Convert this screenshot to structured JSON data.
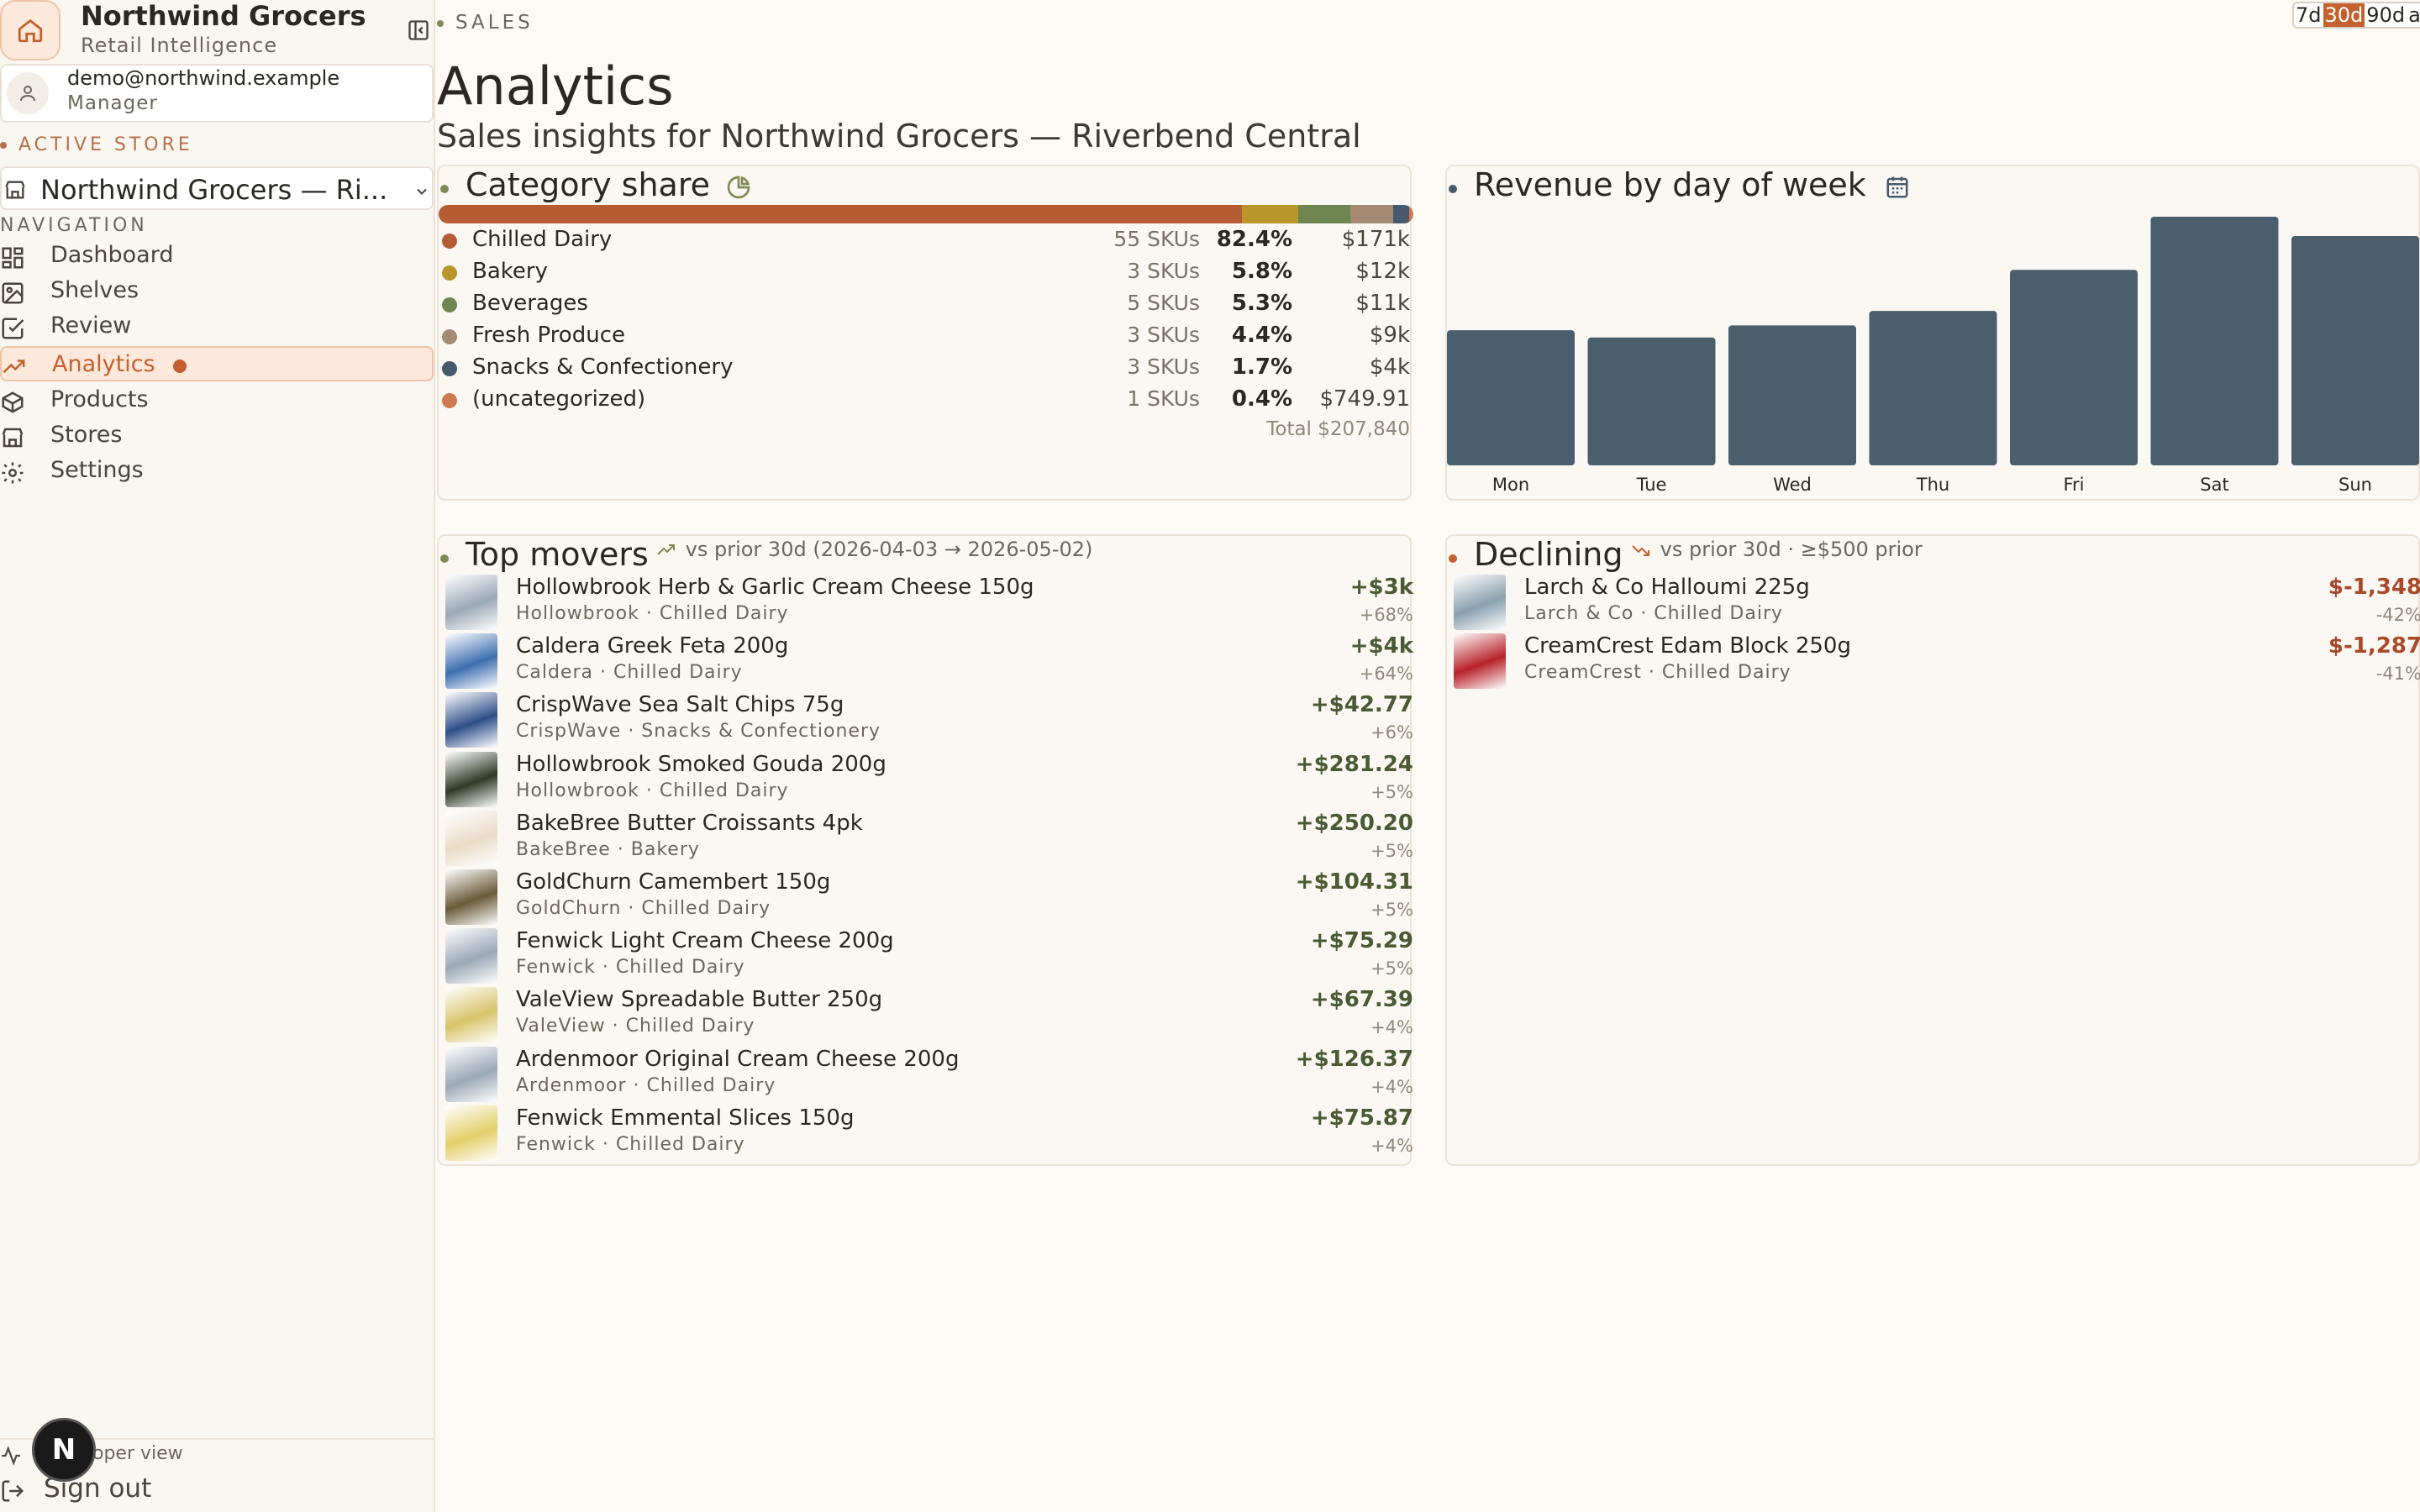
{
  "brand": {
    "name": "Northwind Grocers",
    "subtitle": "Retail Intelligence"
  },
  "user": {
    "email": "demo@northwind.example",
    "role": "Manager"
  },
  "sidebar": {
    "active_store_label": "ACTIVE STORE",
    "store_name": "Northwind Grocers — Ri...",
    "nav_label": "NAVIGATION",
    "items": [
      {
        "label": "Dashboard",
        "icon": "grid-icon"
      },
      {
        "label": "Shelves",
        "icon": "image-icon"
      },
      {
        "label": "Review",
        "icon": "checkbox-icon"
      },
      {
        "label": "Analytics",
        "icon": "trend-up-icon"
      },
      {
        "label": "Products",
        "icon": "box-icon"
      },
      {
        "label": "Stores",
        "icon": "storefront-icon"
      },
      {
        "label": "Settings",
        "icon": "gear-icon"
      }
    ],
    "active_item": "Analytics",
    "developer_view": "oper view",
    "sign_out": "Sign out",
    "avatar_letter": "N"
  },
  "header": {
    "eyebrow": "SALES",
    "title": "Analytics",
    "subtitle": "Sales insights for Northwind Grocers — Riverbend Central",
    "ranges": [
      "7d",
      "30d",
      "90d",
      "all"
    ],
    "selected_range": "30d"
  },
  "category_share": {
    "title": "Category share",
    "rows": [
      {
        "name": "Chilled Dairy",
        "skus": "55 SKUs",
        "pct": "82.4%",
        "amount": "$171k",
        "share": 82.4,
        "color": "#b65c35"
      },
      {
        "name": "Bakery",
        "skus": "3 SKUs",
        "pct": "5.8%",
        "amount": "$12k",
        "share": 5.8,
        "color": "#b8962a"
      },
      {
        "name": "Beverages",
        "skus": "5 SKUs",
        "pct": "5.3%",
        "amount": "$11k",
        "share": 5.3,
        "color": "#6f8650"
      },
      {
        "name": "Fresh Produce",
        "skus": "3 SKUs",
        "pct": "4.4%",
        "amount": "$9k",
        "share": 4.4,
        "color": "#a38a70"
      },
      {
        "name": "Snacks & Confectionery",
        "skus": "3 SKUs",
        "pct": "1.7%",
        "amount": "$4k",
        "share": 1.7,
        "color": "#465a6b"
      },
      {
        "name": "(uncategorized)",
        "skus": "1 SKUs",
        "pct": "0.4%",
        "amount": "$749.91",
        "share": 0.4,
        "color": "#d27a4f"
      }
    ],
    "total": "Total $207,840"
  },
  "chart_data": {
    "type": "bar",
    "title": "Revenue by day of week",
    "categories": [
      "Mon",
      "Tue",
      "Wed",
      "Thu",
      "Fri",
      "Sat",
      "Sun"
    ],
    "values": [
      28,
      26.5,
      29,
      32,
      40.5,
      51.5,
      47.5
    ],
    "color": "#4a5f6e"
  },
  "top_movers": {
    "title": "Top movers",
    "note": "vs prior 30d (2026-04-03 → 2026-05-02)",
    "items": [
      {
        "name": "Hollowbrook Herb & Garlic Cream Cheese 150g",
        "meta": "Hollowbrook · Chilled Dairy",
        "value": "+$3k",
        "change": "+68%",
        "thumb": "#9aa8b6"
      },
      {
        "name": "Caldera Greek Feta 200g",
        "meta": "Caldera · Chilled Dairy",
        "value": "+$4k",
        "change": "+64%",
        "thumb": "#3f6fb0"
      },
      {
        "name": "CrispWave Sea Salt Chips 75g",
        "meta": "CrispWave · Snacks & Confectionery",
        "value": "+$42.77",
        "change": "+6%",
        "thumb": "#2f4f8a"
      },
      {
        "name": "Hollowbrook Smoked Gouda 200g",
        "meta": "Hollowbrook · Chilled Dairy",
        "value": "+$281.24",
        "change": "+5%",
        "thumb": "#2d3b26"
      },
      {
        "name": "BakeBree Butter Croissants 4pk",
        "meta": "BakeBree · Bakery",
        "value": "+$250.20",
        "change": "+5%",
        "thumb": "#e9dcc8"
      },
      {
        "name": "GoldChurn Camembert 150g",
        "meta": "GoldChurn · Chilled Dairy",
        "value": "+$104.31",
        "change": "+5%",
        "thumb": "#6b5a3a"
      },
      {
        "name": "Fenwick Light Cream Cheese 200g",
        "meta": "Fenwick · Chilled Dairy",
        "value": "+$75.29",
        "change": "+5%",
        "thumb": "#9aa8b6"
      },
      {
        "name": "ValeView Spreadable Butter 250g",
        "meta": "ValeView · Chilled Dairy",
        "value": "+$67.39",
        "change": "+4%",
        "thumb": "#d8c46a"
      },
      {
        "name": "Ardenmoor Original Cream Cheese 200g",
        "meta": "Ardenmoor · Chilled Dairy",
        "value": "+$126.37",
        "change": "+4%",
        "thumb": "#9aa8b6"
      },
      {
        "name": "Fenwick Emmental Slices 150g",
        "meta": "Fenwick · Chilled Dairy",
        "value": "+$75.87",
        "change": "+4%",
        "thumb": "#e3cf6a"
      }
    ]
  },
  "declining": {
    "title": "Declining",
    "note": "vs prior 30d · ≥$500 prior",
    "items": [
      {
        "name": "Larch & Co Halloumi 225g",
        "meta": "Larch & Co · Chilled Dairy",
        "value": "$-1,348",
        "change": "-42%",
        "thumb": "#8aa0b0"
      },
      {
        "name": "CreamCrest Edam Block 250g",
        "meta": "CreamCrest · Chilled Dairy",
        "value": "$-1,287",
        "change": "-41%",
        "thumb": "#b8222a"
      }
    ]
  }
}
